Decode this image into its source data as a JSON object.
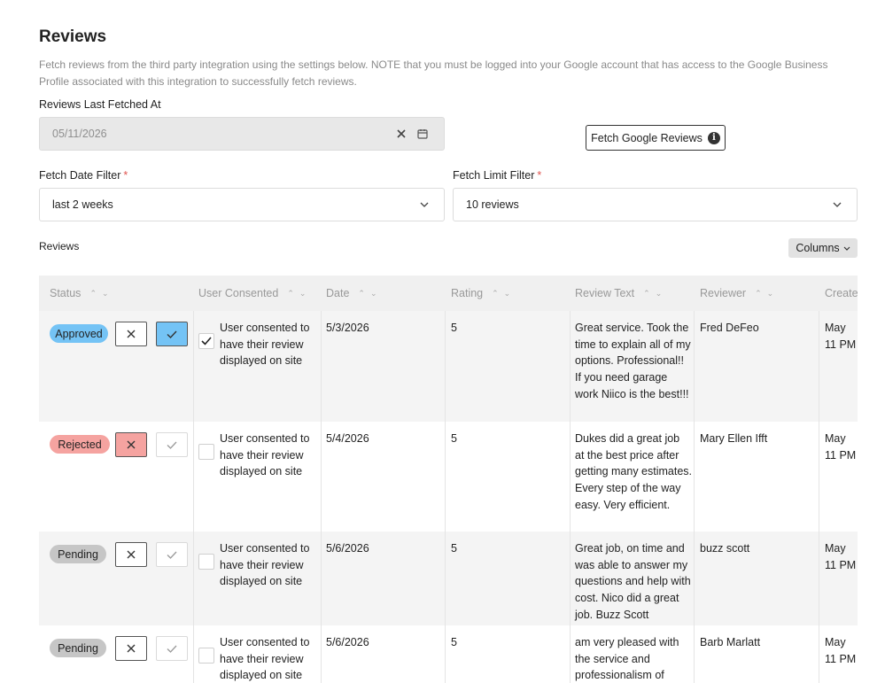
{
  "page": {
    "title": "Reviews",
    "description": "Fetch reviews from the third party integration using the settings below. NOTE that you must be logged into your Google account that has access to the Google Business Profile associated with this integration to successfully fetch reviews."
  },
  "last_fetched": {
    "label": "Reviews Last Fetched At",
    "value": "05/11/2026"
  },
  "fetch_button": {
    "label": "Fetch Google Reviews",
    "icon": "info-icon"
  },
  "date_filter": {
    "label": "Fetch Date Filter",
    "required_mark": "*",
    "value": "last 2 weeks"
  },
  "limit_filter": {
    "label": "Fetch Limit Filter",
    "required_mark": "*",
    "value": "10 reviews"
  },
  "reviews_section": {
    "label": "Reviews",
    "columns_button": "Columns"
  },
  "table": {
    "headers": {
      "status": "Status",
      "consented": "User Consented",
      "date": "Date",
      "rating": "Rating",
      "review_text": "Review Text",
      "reviewer": "Reviewer",
      "created": "Created"
    },
    "rows": [
      {
        "status": "Approved",
        "consent_text": "User consented to have their review displayed on site",
        "consented": true,
        "date": "5/3/2026",
        "rating": "5",
        "review_text": "Great service. Took the time to explain all of my options. Professional!! If you need garage work Niico is the best!!!",
        "reviewer": "Fred DeFeo",
        "created": "May 11 PM"
      },
      {
        "status": "Rejected",
        "consent_text": "User consented to have their review displayed on site",
        "consented": false,
        "date": "5/4/2026",
        "rating": "5",
        "review_text": "Dukes did a great job at the best price after getting many estimates. Every step of the way easy. Very efficient.",
        "reviewer": "Mary Ellen Ifft",
        "created": "May 11 PM"
      },
      {
        "status": "Pending",
        "consent_text": "User consented to have their review displayed on site",
        "consented": false,
        "date": "5/6/2026",
        "rating": "5",
        "review_text": "Great job, on time and was able to answer my questions and help with cost. Nico did a great job. Buzz Scott",
        "reviewer": "buzz scott",
        "created": "May 11 PM"
      },
      {
        "status": "Pending",
        "consent_text": "User consented to have their review displayed on site",
        "consented": false,
        "date": "5/6/2026",
        "rating": "5",
        "review_text": "am very pleased with the service and professionalism of",
        "reviewer": "Barb Marlatt",
        "created": "May 11 PM"
      }
    ]
  },
  "colors": {
    "approved": "#74c3f5",
    "rejected": "#f5a3a0",
    "pending": "#c6c6c6",
    "required": "#e0544f"
  }
}
